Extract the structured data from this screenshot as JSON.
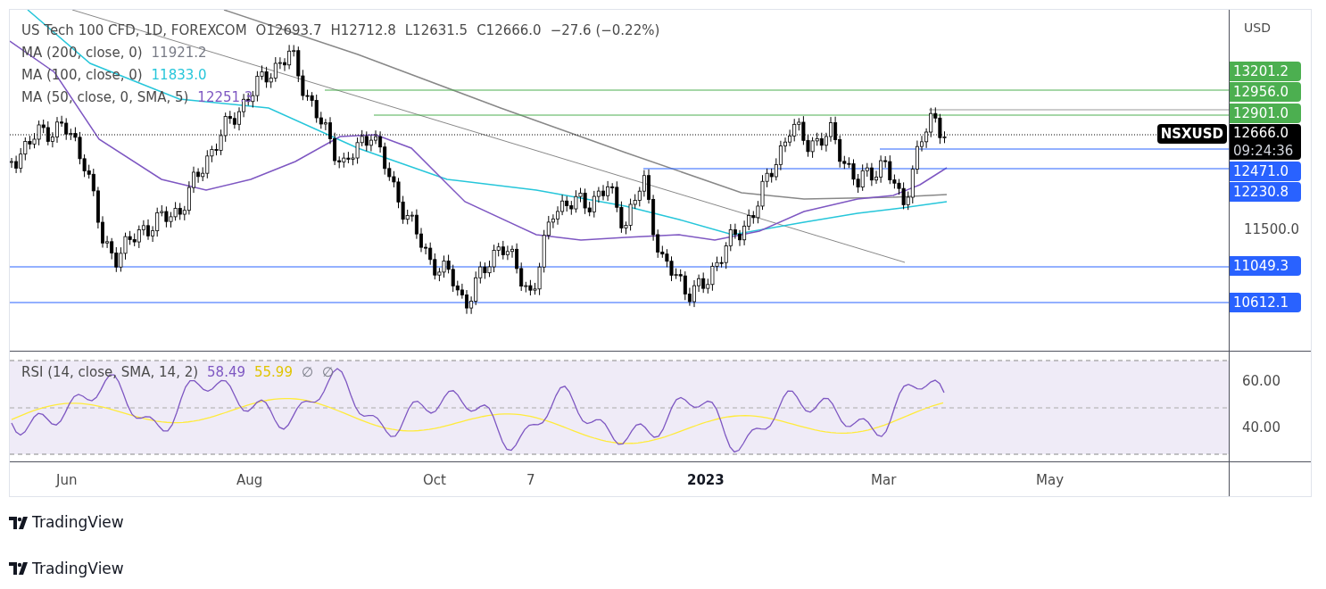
{
  "header": {
    "symbol": "US Tech 100 CFD, 1D, FOREXCOM",
    "open": "O12693.7",
    "high": "H12712.8",
    "low": "L12631.5",
    "close": "C12666.0",
    "change": "−27.6 (−0.22%)"
  },
  "indicators": [
    {
      "label": "MA (200, close, 0)",
      "value": "11921.2",
      "color": "#787b86"
    },
    {
      "label": "MA (100, close, 0)",
      "value": "11833.0",
      "color": "#26c6da"
    },
    {
      "label": "MA (50, close, 0, SMA, 5)",
      "value": "12251.3",
      "color": "#7e57c2"
    }
  ],
  "price_axis": {
    "currency": "USD",
    "ticks": [
      "11500.0"
    ]
  },
  "price_tags": [
    {
      "value": "13201.2",
      "color": "#4caf50"
    },
    {
      "value": "12956.0",
      "color": "#4caf50"
    },
    {
      "value": "12901.0",
      "color": "#4caf50"
    },
    {
      "value": "12471.0",
      "color": "#2962ff"
    },
    {
      "value": "12230.8",
      "color": "#2962ff"
    },
    {
      "value": "11049.3",
      "color": "#2962ff"
    },
    {
      "value": "10612.1",
      "color": "#2962ff"
    }
  ],
  "current": {
    "symbol": "NSXUSD",
    "price": "12666.0",
    "countdown": "09:24:36"
  },
  "rsi": {
    "label": "RSI (14, close, SMA, 14, 2)",
    "values": [
      {
        "text": "58.49",
        "color": "#7e57c2"
      },
      {
        "text": "55.99",
        "color": "#e0c400"
      },
      {
        "text": "∅",
        "color": "#787b86"
      },
      {
        "text": "∅",
        "color": "#787b86"
      }
    ],
    "ticks": [
      "60.00",
      "40.00"
    ]
  },
  "time_axis": [
    {
      "label": "Jun",
      "bold": false
    },
    {
      "label": "Aug",
      "bold": false
    },
    {
      "label": "Oct",
      "bold": false
    },
    {
      "label": "7",
      "bold": false
    },
    {
      "label": "2023",
      "bold": true
    },
    {
      "label": "Mar",
      "bold": false
    },
    {
      "label": "May",
      "bold": false
    }
  ],
  "footer": [
    "TradingView",
    "TradingView"
  ]
}
